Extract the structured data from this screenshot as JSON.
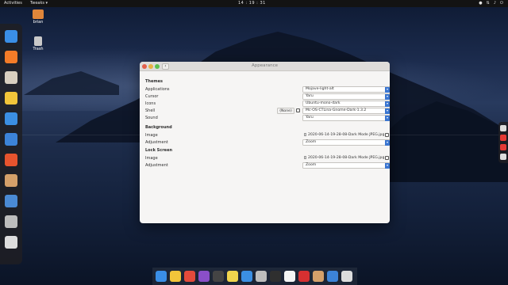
{
  "topbar": {
    "activities": "Activities",
    "app_menu": "Tweaks ▾",
    "clock": "14 : 19 : 31"
  },
  "desktop": {
    "icons": [
      {
        "label": "brian",
        "icon": "folder-icon"
      },
      {
        "label": "Trash",
        "icon": "trash-icon"
      }
    ]
  },
  "window": {
    "title": "Appearance",
    "sections": {
      "themes": {
        "heading": "Themes",
        "rows": [
          {
            "label": "Applications",
            "value": "Mojave-light-alt"
          },
          {
            "label": "Cursor",
            "value": "Yaru"
          },
          {
            "label": "Icons",
            "value": "Ubuntu-mono-dark"
          },
          {
            "label": "Shell",
            "value": "Mc-OS-CTLina-Gnome-Dark-1.3.2",
            "button": "(None)"
          },
          {
            "label": "Sound",
            "value": "Yaru"
          }
        ]
      },
      "background": {
        "heading": "Background",
        "image_label": "Image",
        "image_value": "2020-06-14-19-28-08-Dark Mode JPEG.jpg",
        "adjust_label": "Adjustment",
        "adjust_value": "Zoom"
      },
      "lock": {
        "heading": "Lock Screen",
        "image_label": "Image",
        "image_value": "2020-06-14-19-28-08-Dark Mode JPEG.jpg",
        "adjust_label": "Adjustment",
        "adjust_value": "Zoom"
      }
    }
  },
  "colors": {
    "accent": "#3b76d1",
    "close": "#e2604d",
    "minimize": "#eab142",
    "maximize": "#5fc04f",
    "topbar": "#131313"
  },
  "docks": {
    "left": [
      {
        "icon": "thunderbird-icon",
        "color": "#3a8ee6"
      },
      {
        "icon": "firefox-icon",
        "color": "#f57c28"
      },
      {
        "icon": "files-icon",
        "color": "#d8cfc0"
      },
      {
        "icon": "rhythmbox-icon",
        "color": "#f2c53a"
      },
      {
        "icon": "libreoffice-writer-icon",
        "color": "#3b8fe3"
      },
      {
        "icon": "software-center-icon",
        "color": "#3c83d8"
      },
      {
        "icon": "help-icon",
        "color": "#e7542e"
      },
      {
        "icon": "archive-icon",
        "color": "#d4a06a"
      },
      {
        "icon": "document-viewer-icon",
        "color": "#4a8ad4"
      },
      {
        "icon": "trash-dock-icon",
        "color": "#bdbdbd"
      },
      {
        "icon": "show-apps-icon",
        "color": "#dddddd"
      }
    ],
    "bottom": [
      {
        "icon": "thunderbird-icon",
        "color": "#3a8ee6"
      },
      {
        "icon": "rhythmbox-icon",
        "color": "#f2c53a"
      },
      {
        "icon": "chrome-icon",
        "color": "#e34a3b"
      },
      {
        "icon": "image-viewer-icon",
        "color": "#8a4fc8"
      },
      {
        "icon": "video-icon",
        "color": "#444444"
      },
      {
        "icon": "notes-icon",
        "color": "#f0d44d"
      },
      {
        "icon": "folder-icon",
        "color": "#3b8fe3"
      },
      {
        "icon": "trash-dock-icon",
        "color": "#bdbdbd"
      },
      {
        "icon": "terminal-icon",
        "color": "#2f2f2f"
      },
      {
        "icon": "documents-icon",
        "color": "#f5f5f5"
      },
      {
        "icon": "screen-recorder-icon",
        "color": "#d63031"
      },
      {
        "icon": "archive-icon",
        "color": "#d4a06a"
      },
      {
        "icon": "software-center-icon",
        "color": "#3c83d8"
      },
      {
        "icon": "show-apps-icon",
        "color": "#dddddd"
      }
    ],
    "right": [
      {
        "icon": "camera-icon",
        "color": "#dddddd"
      },
      {
        "icon": "record-icon",
        "color": "#e53935"
      },
      {
        "icon": "video-camera-icon",
        "color": "#e53935"
      },
      {
        "icon": "gear-icon",
        "color": "#dddddd"
      }
    ]
  }
}
